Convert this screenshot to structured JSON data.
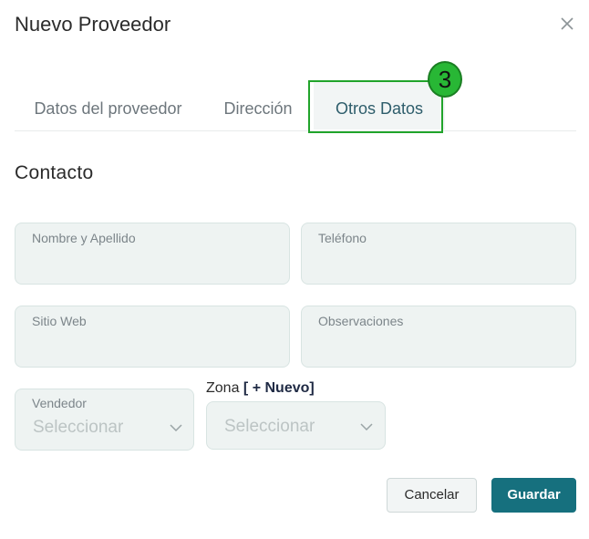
{
  "dialog": {
    "title": "Nuevo Proveedor"
  },
  "tabs": [
    {
      "label": "Datos del proveedor",
      "active": false
    },
    {
      "label": "Dirección",
      "active": false
    },
    {
      "label": "Otros Datos",
      "active": true
    }
  ],
  "step_badge": "3",
  "section": {
    "title": "Contacto"
  },
  "fields": {
    "nombre": {
      "label": "Nombre y Apellido",
      "value": ""
    },
    "telefono": {
      "label": "Teléfono",
      "value": ""
    },
    "sitio_web": {
      "label": "Sitio Web",
      "value": ""
    },
    "observaciones": {
      "label": "Observaciones",
      "value": ""
    }
  },
  "vendedor": {
    "label": "Vendedor",
    "value": "Seleccionar"
  },
  "zona": {
    "label": "Zona",
    "new_link": "[ + Nuevo]",
    "value": "Seleccionar"
  },
  "buttons": {
    "cancel": "Cancelar",
    "save": "Guardar"
  },
  "colors": {
    "accent": "#16707e",
    "highlight": "#21a42b",
    "field_bg": "#eef3f2"
  },
  "icons": {
    "close": "close-icon",
    "chevron": "chevron-down-icon"
  }
}
